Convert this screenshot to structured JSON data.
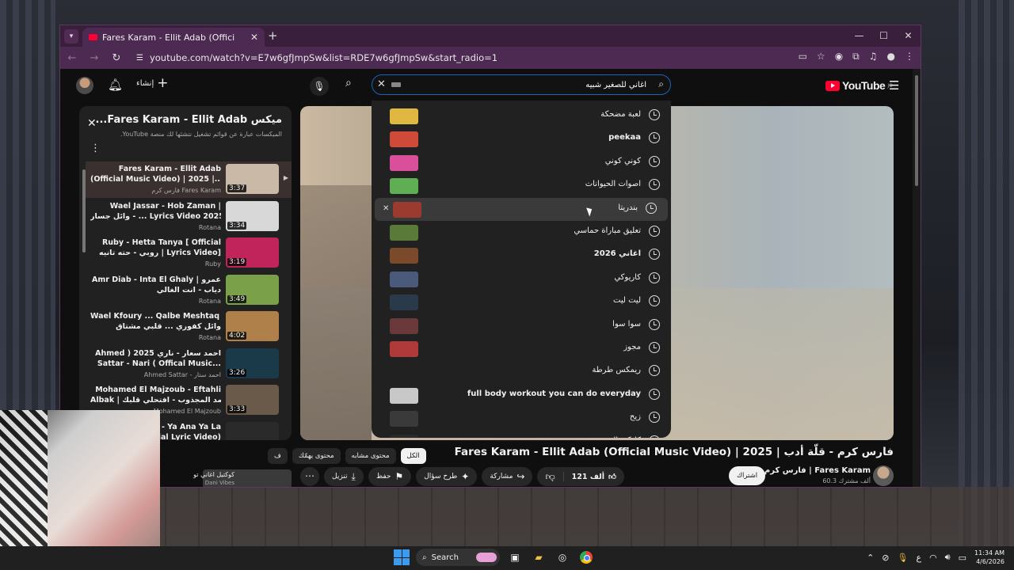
{
  "browser": {
    "tab_title": "Fares Karam - Ellit Adab (Offici",
    "url": "youtube.com/watch?v=E7w6gfJmpSw&list=RDE7w6gfJmpSw&start_radio=1",
    "controls": {
      "minimize": "—",
      "maximize": "☐",
      "close": "✕"
    }
  },
  "masthead": {
    "create_label": "إنشاء",
    "search_value": "اغاني للصغير شبيه",
    "logo_text": "YouTube",
    "logo_region": "JO"
  },
  "suggestions": [
    {
      "text": "لعبة مضحكة",
      "bold": false,
      "thumb": "#e0b740",
      "has_thumb": true
    },
    {
      "text": "peekaa",
      "bold": true,
      "thumb": "#d04a3a",
      "has_thumb": true
    },
    {
      "text": "كوني كوني",
      "bold": false,
      "thumb": "#d94f9a",
      "has_thumb": true
    },
    {
      "text": "اصوات الحيوانات",
      "bold": false,
      "thumb": "#5fae53",
      "has_thumb": true
    },
    {
      "text": "بندريتا",
      "bold": false,
      "thumb": "#9b3a2e",
      "has_thumb": true,
      "highlighted": true
    },
    {
      "text": "تعليق مباراة حماسي",
      "bold": false,
      "thumb": "#5a7a3a",
      "has_thumb": true
    },
    {
      "text": "اغاني 2026",
      "bold": true,
      "thumb": "#7a4a2a",
      "has_thumb": true
    },
    {
      "text": "كاريوكي",
      "bold": false,
      "thumb": "#4a5a7a",
      "has_thumb": true
    },
    {
      "text": "ليت ليت",
      "bold": false,
      "thumb": "#2a3a4a",
      "has_thumb": true
    },
    {
      "text": "سوا سوا",
      "bold": false,
      "thumb": "#6a3a3a",
      "has_thumb": true
    },
    {
      "text": "مجوز",
      "bold": false,
      "thumb": "#b03a3a",
      "has_thumb": true
    },
    {
      "text": "ريمكس طرطة",
      "bold": false,
      "thumb": "",
      "has_thumb": false
    },
    {
      "text": "full body workout you can do everyday",
      "bold": true,
      "thumb": "#c8c8c8",
      "has_thumb": true
    },
    {
      "text": "زيح",
      "bold": false,
      "thumb": "#3a3a3a",
      "has_thumb": true
    },
    {
      "text": "كاركي الس",
      "bold": false,
      "thumb": "#2a2a2a",
      "has_thumb": true
    }
  ],
  "playlist": {
    "title": "ميكس Fares Karam - Ellit Adab...",
    "subtitle": "الميكسات عبارة عن قوائم تشغيل نتشئها لك منصة YouTube.",
    "items": [
      {
        "t1": "Fares Karam - Ellit Adab",
        "t2": "(Official Music Video) | 2025 |...",
        "ch": "فارس كرم Fares Karam",
        "dur": "3:37",
        "thumb": "#c9b9a6",
        "active": true
      },
      {
        "t1": "Wael Jassar - Hob Zaman |",
        "t2": "وائل جسار - ... Lyrics Video 2025 |",
        "ch": "Rotana",
        "dur": "3:34",
        "thumb": "#d8d8d8"
      },
      {
        "t1": "Ruby - Hetta Tanya [ Official",
        "t2": "روبي - حته تانيه | Lyrics Video]",
        "ch": "Ruby",
        "dur": "3:19",
        "thumb": "#c0245a"
      },
      {
        "t1": "Amr Diab - Inta El Ghaly | عمرو",
        "t2": "دياب - انت الغالي",
        "ch": "Rotana",
        "dur": "3:49",
        "thumb": "#7aa04a"
      },
      {
        "t1": "Wael Kfoury ... Qalbe Meshtaq |",
        "t2": "وائل كفوري ... قلبي مشتاق",
        "ch": "Rotana",
        "dur": "4:02",
        "thumb": "#b0804a"
      },
      {
        "t1": "Ahmed ) 2025 احمد سعار - ناري",
        "t2": "Sattar - Nari ( Offical Music...",
        "ch": "Ahmed Sattar - احمد ستار",
        "dur": "3:26",
        "thumb": "#1a3a4a"
      },
      {
        "t1": "Mohamed El Majzoub - Eftahli",
        "t2": "Albak | محمد المجذوب - افتحلي قلبك...",
        "ch": "Mohamed El Majzoub",
        "dur": "3:33",
        "thumb": "#6a5a4a"
      },
      {
        "t1": "Diab - Ya Ana Ya La",
        "t2": "Official Lyric Video)",
        "ch": "",
        "dur": "",
        "thumb": "#2a2a2a"
      }
    ]
  },
  "video": {
    "title": "فارس كرم - قلّة أدب | Fares Karam - Ellit Adab (Official Music Video) | 2025",
    "channel": "Fares Karam | فارس كرم",
    "subs": "60.3 ألف مشترك",
    "subscribe": "اشتراك",
    "likes": "121 ألف",
    "share": "مشاركة",
    "ask": "طرح سؤال",
    "save": "حفظ",
    "download": "تنزيل"
  },
  "chips": [
    "الكل",
    "محتوى مشابه",
    "محتوى يهمّك",
    "ف"
  ],
  "rec": {
    "title": "كوكتيل اغاني تو",
    "channel": "Dani Vibes"
  },
  "taskbar": {
    "search": "Search",
    "time": "11:34 AM",
    "date": "4/6/2026",
    "lang": "ع"
  }
}
